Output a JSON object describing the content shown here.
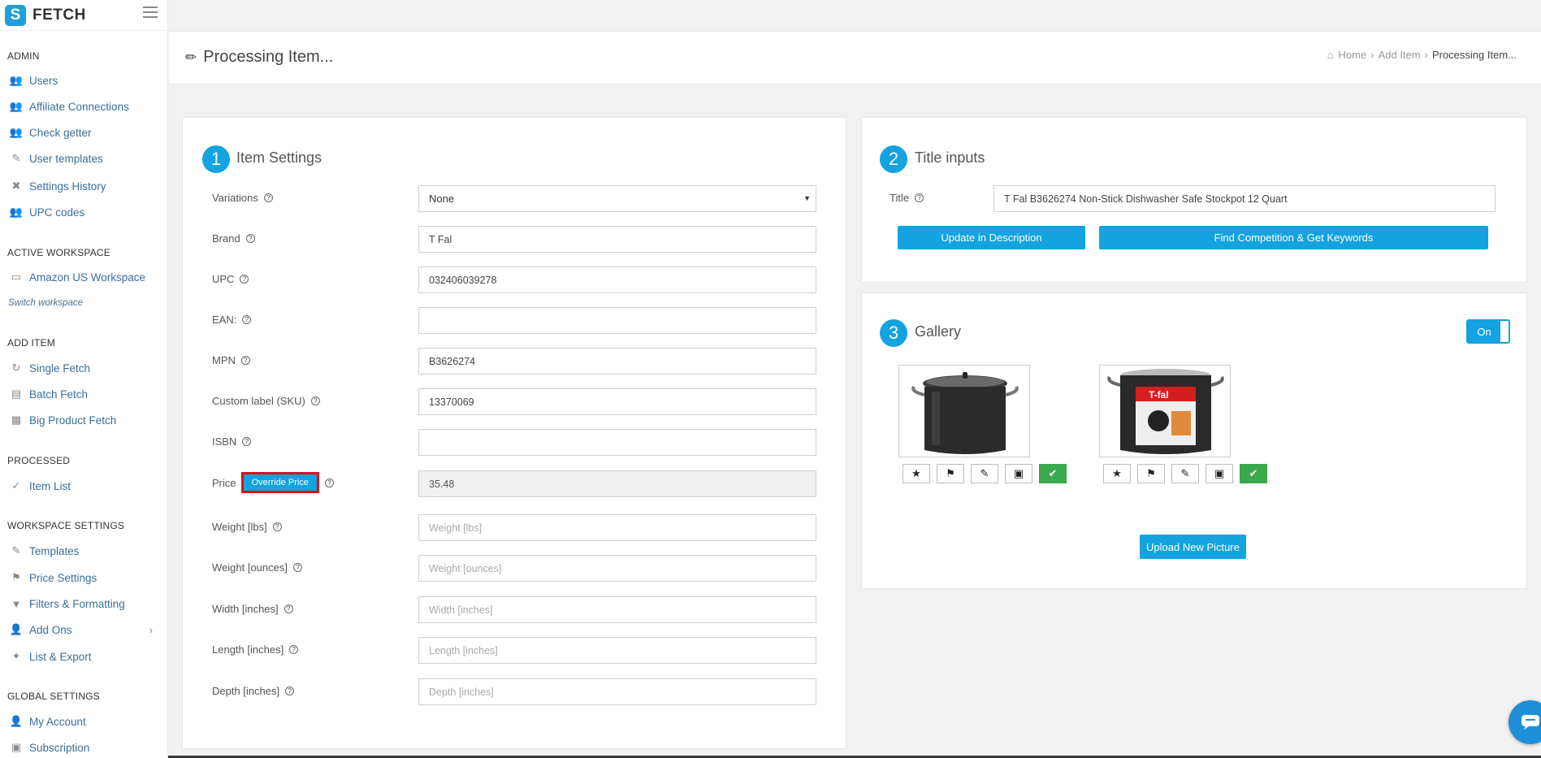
{
  "app": {
    "name": "FETCH"
  },
  "sidebar": {
    "sections": [
      {
        "title": "ADMIN",
        "items": [
          {
            "label": "Users",
            "icon": "users-icon"
          },
          {
            "label": "Affiliate Connections",
            "icon": "users-icon"
          },
          {
            "label": "Check getter",
            "icon": "users-icon"
          },
          {
            "label": "User templates",
            "icon": "pencil-icon"
          },
          {
            "label": "Settings History",
            "icon": "wrench-icon"
          },
          {
            "label": "UPC codes",
            "icon": "users-icon"
          }
        ]
      },
      {
        "title": "ACTIVE WORKSPACE",
        "items": [
          {
            "label": "Amazon US Workspace",
            "icon": "monitor-icon"
          },
          {
            "label": "Switch workspace",
            "icon": ""
          }
        ]
      },
      {
        "title": "ADD ITEM",
        "items": [
          {
            "label": "Single Fetch",
            "icon": "fetch-icon"
          },
          {
            "label": "Batch Fetch",
            "icon": "batch-icon"
          },
          {
            "label": "Big Product Fetch",
            "icon": "big-fetch-icon"
          }
        ]
      },
      {
        "title": "PROCESSED",
        "items": [
          {
            "label": "Item List",
            "icon": "list-check-icon"
          }
        ]
      },
      {
        "title": "WORKSPACE SETTINGS",
        "items": [
          {
            "label": "Templates",
            "icon": "pencil-icon"
          },
          {
            "label": "Price Settings",
            "icon": "tag-icon"
          },
          {
            "label": "Filters & Formatting",
            "icon": "filter-icon"
          },
          {
            "label": "Add Ons",
            "icon": "user-plus-icon"
          },
          {
            "label": "List & Export",
            "icon": "wand-icon"
          }
        ]
      },
      {
        "title": "GLOBAL SETTINGS",
        "items": [
          {
            "label": "My Account",
            "icon": "user-icon"
          },
          {
            "label": "Subscription",
            "icon": "subscription-icon"
          }
        ]
      }
    ]
  },
  "header": {
    "title": "Processing Item...",
    "breadcrumb": [
      "Home",
      "Add Item",
      "Processing Item..."
    ]
  },
  "item_settings": {
    "number": "1",
    "title": "Item Settings",
    "variations": {
      "label": "Variations",
      "value": "None"
    },
    "brand": {
      "label": "Brand",
      "value": "T Fal"
    },
    "upc": {
      "label": "UPC",
      "value": "032406039278"
    },
    "ean": {
      "label": "EAN:",
      "value": ""
    },
    "mpn": {
      "label": "MPN",
      "value": "B3626274"
    },
    "sku": {
      "label": "Custom label (SKU)",
      "value": "13370069"
    },
    "isbn": {
      "label": "ISBN",
      "value": ""
    },
    "price": {
      "label": "Price",
      "override_label": "Override Price",
      "value": "35.48"
    },
    "weight_lbs": {
      "label": "Weight [lbs]",
      "placeholder": "Weight [lbs]"
    },
    "weight_oz": {
      "label": "Weight [ounces]",
      "placeholder": "Weight [ounces]"
    },
    "width": {
      "label": "Width [inches]",
      "placeholder": "Width [inches]"
    },
    "length": {
      "label": "Length [inches]",
      "placeholder": "Length [inches]"
    },
    "depth": {
      "label": "Depth [inches]",
      "placeholder": "Depth [inches]"
    }
  },
  "title_inputs": {
    "number": "2",
    "title": "Title inputs",
    "field_label": "Title",
    "value": "T Fal B3626274 Non-Stick Dishwasher Safe Stockpot 12 Quart",
    "update_button": "Update in Description",
    "competition_button": "Find Competition & Get Keywords"
  },
  "gallery": {
    "number": "3",
    "title": "Gallery",
    "toggle_label": "On",
    "upload_button": "Upload New Picture",
    "brand_on_box": "T-fal"
  },
  "colors": {
    "accent": "#12a3e0",
    "success": "#3aa84b",
    "highlight": "#dd1111"
  }
}
